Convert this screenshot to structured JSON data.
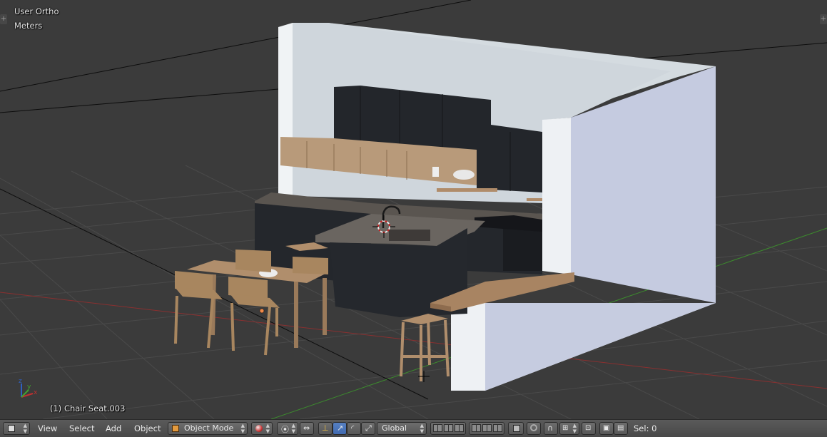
{
  "viewport": {
    "view_label": "User Ortho",
    "units_label": "Meters",
    "active_object_label": "(1) Chair Seat.003"
  },
  "header": {
    "menus": [
      "View",
      "Select",
      "Add",
      "Object"
    ],
    "mode": "Object Mode",
    "orientation": "Global",
    "selection_count": "Sel: 0"
  },
  "icons": {
    "editor_type": "cube-icon",
    "axis_widget": "xyz-axis-icon",
    "cursor": "3d-cursor-icon"
  },
  "colors": {
    "viewport_bg": "#3b3b3b",
    "header_bg": "#4f4f4f",
    "active_button": "#4a73b8",
    "axis_x": "#a03232",
    "axis_y": "#3c9a2e",
    "axis_z": "#2f5fb0"
  }
}
